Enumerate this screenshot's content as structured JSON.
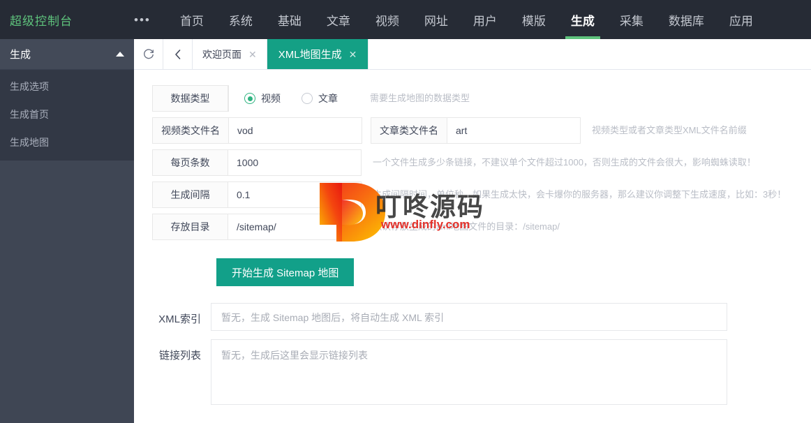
{
  "topnav": {
    "brand": "超级控制台",
    "more_icon": "•••",
    "items": [
      {
        "label": "首页",
        "active": false
      },
      {
        "label": "系统",
        "active": false
      },
      {
        "label": "基础",
        "active": false
      },
      {
        "label": "文章",
        "active": false
      },
      {
        "label": "视频",
        "active": false
      },
      {
        "label": "网址",
        "active": false
      },
      {
        "label": "用户",
        "active": false
      },
      {
        "label": "模版",
        "active": false
      },
      {
        "label": "生成",
        "active": true
      },
      {
        "label": "采集",
        "active": false
      },
      {
        "label": "数据库",
        "active": false
      },
      {
        "label": "应用",
        "active": false
      }
    ]
  },
  "sidebar": {
    "group_title": "生成",
    "items": [
      {
        "label": "生成选项"
      },
      {
        "label": "生成首页"
      },
      {
        "label": "生成地图"
      }
    ]
  },
  "tabbar": {
    "refresh_icon": "↻",
    "back_icon": "‹",
    "tabs": [
      {
        "label": "欢迎页面",
        "close": "✕",
        "active": false
      },
      {
        "label": "XML地图生成",
        "close": "✕",
        "active": true
      }
    ]
  },
  "form": {
    "data_type": {
      "label": "数据类型",
      "options": [
        {
          "label": "视频",
          "selected": true
        },
        {
          "label": "文章",
          "selected": false
        }
      ],
      "hint": "需要生成地图的数据类型"
    },
    "video_filename": {
      "label": "视频类文件名",
      "value": "vod"
    },
    "article_filename": {
      "label": "文章类文件名",
      "value": "art",
      "hint": "视频类型或者文章类型XML文件名前缀"
    },
    "per_page": {
      "label": "每页条数",
      "value": "1000",
      "hint": "一个文件生成多少条链接，不建议单个文件超过1000，否则生成的文件会很大，影响蜘蛛读取！"
    },
    "interval": {
      "label": "生成间隔",
      "value": "0.1",
      "hint": "生成间隔时间，单位秒，如果生成太快，会卡爆你的服务器，那么建议你调整下生成速度，比如：3秒！"
    },
    "directory": {
      "label": "存放目录",
      "value": "/sitemap/",
      "hint": "默认存放生成的xml地图文件的目录：/sitemap/"
    },
    "submit_label": "开始生成 Sitemap 地图"
  },
  "output": {
    "xml_index": {
      "label": "XML索引",
      "text": "暂无，生成 Sitemap 地图后，将自动生成 XML 索引"
    },
    "link_list": {
      "label": "链接列表",
      "text": "暂无，生成后这里会显示链接列表"
    }
  },
  "watermark": {
    "brand": "叮咚源码",
    "url": "www.dinfly.com"
  },
  "colors": {
    "nav_bg": "#262b35",
    "brand_green": "#5ec27c",
    "sidebar_bg": "#3f4654",
    "sidebar_sub_bg": "#323845",
    "tab_active": "#14a085",
    "button": "#12a089",
    "radio_on": "#2fb380",
    "hint_text": "#b9bdc6",
    "watermark_url": "#e4322b"
  }
}
